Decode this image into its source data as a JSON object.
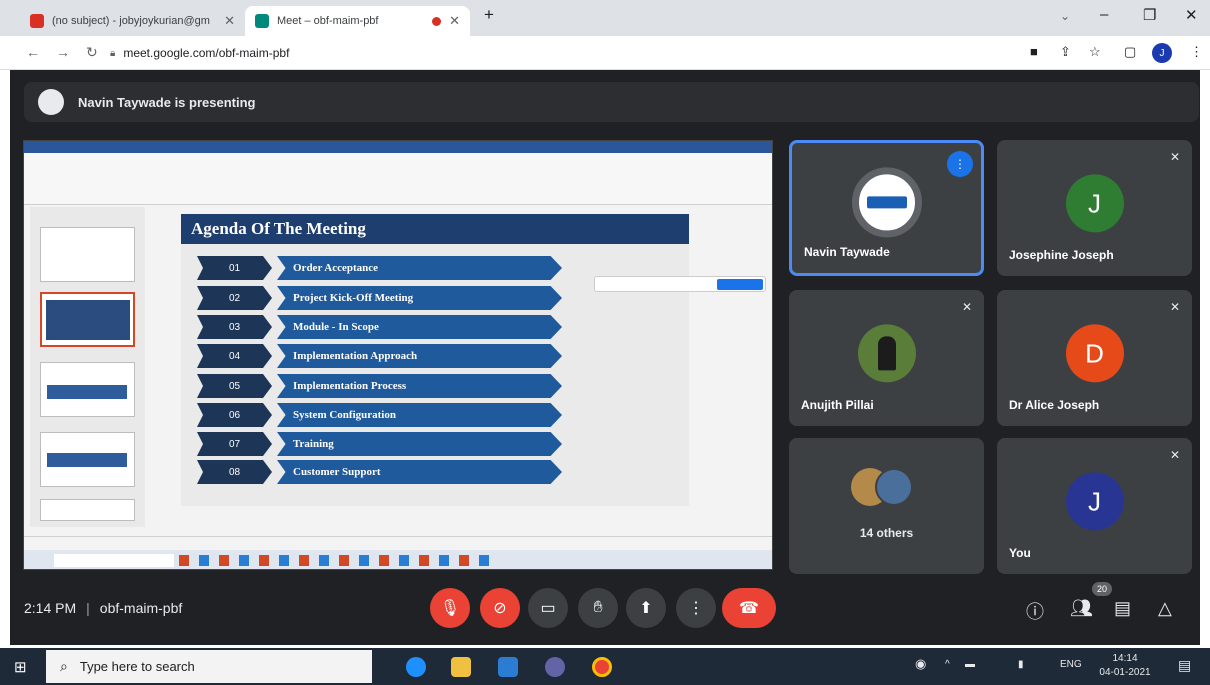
{
  "browser": {
    "tabs": [
      {
        "title": "(no subject) - jobyjoykurian@gm",
        "active": false
      },
      {
        "title": "Meet – obf-maim-pbf",
        "active": true
      }
    ],
    "new_tab_label": "+",
    "url": "meet.google.com/obf-maim-pbf",
    "profile_initial": "J"
  },
  "meet": {
    "presenting_banner": "Navin Taywade is presenting",
    "meeting_time": "2:14 PM",
    "meeting_code": "obf-maim-pbf",
    "participant_count": "20",
    "participants": [
      {
        "name": "Navin Taywade",
        "initial": "",
        "avatar_color": "#ffffff",
        "speaking": true,
        "muted": false
      },
      {
        "name": "Josephine Joseph",
        "initial": "J",
        "avatar_color": "#2e7d32",
        "speaking": false,
        "muted": true
      },
      {
        "name": "Anujith Pillai",
        "initial": "",
        "avatar_color": "#5a7d3a",
        "speaking": false,
        "muted": true
      },
      {
        "name": "Dr Alice Joseph",
        "initial": "D",
        "avatar_color": "#e64a19",
        "speaking": false,
        "muted": true
      },
      {
        "name": "14 others",
        "initial": "",
        "avatar_color": "#3c4043",
        "speaking": false,
        "muted": false
      },
      {
        "name": "You",
        "initial": "J",
        "avatar_color": "#283593",
        "speaking": false,
        "muted": true
      }
    ]
  },
  "shared_slide": {
    "title": "Agenda Of The Meeting",
    "items": [
      {
        "num": "01",
        "label": "Order Acceptance"
      },
      {
        "num": "02",
        "label": "Project Kick-Off Meeting"
      },
      {
        "num": "03",
        "label": "Module - In Scope"
      },
      {
        "num": "04",
        "label": "Implementation Approach"
      },
      {
        "num": "05",
        "label": "Implementation Process"
      },
      {
        "num": "06",
        "label": "System Configuration"
      },
      {
        "num": "07",
        "label": "Training"
      },
      {
        "num": "08",
        "label": "Customer Support"
      }
    ]
  },
  "taskbar": {
    "search_placeholder": "Type here to search",
    "language": "ENG",
    "time": "14:14",
    "date": "04-01-2021"
  },
  "colors": {
    "meet_bg": "#202124",
    "tile_bg": "#3c4043",
    "danger": "#ea4335",
    "accent": "#4c8bf5",
    "slide_title": "#1d3e6e",
    "agenda_bar": "#1f5a9c"
  },
  "icons": [
    "gmail-icon",
    "meet-icon",
    "back-icon",
    "forward-icon",
    "reload-icon",
    "lock-icon",
    "camera-icon",
    "share-icon",
    "star-icon",
    "mic-off-icon",
    "camera-off-icon",
    "captions-icon",
    "raise-hand-icon",
    "present-icon",
    "more-options-icon",
    "end-call-icon",
    "info-icon",
    "people-icon",
    "chat-icon",
    "activities-icon",
    "windows-icon",
    "search-icon"
  ]
}
